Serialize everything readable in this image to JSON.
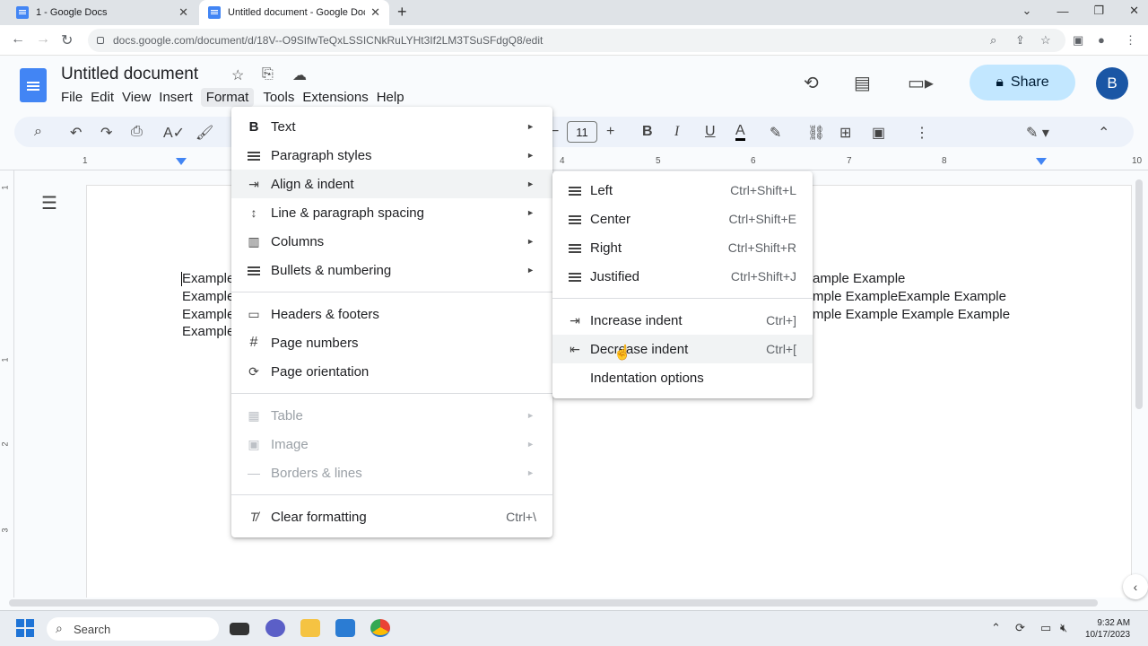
{
  "browser": {
    "tabs": [
      {
        "title": "1 - Google Docs",
        "active": false
      },
      {
        "title": "Untitled document - Google Docs",
        "active": true
      }
    ],
    "url": "docs.google.com/document/d/18V--O9SIfwTeQxLSSICNkRuLYHt3If2LM3TSuSFdgQ8/edit"
  },
  "docs": {
    "title": "Untitled document",
    "menubar": [
      "File",
      "Edit",
      "View",
      "Insert",
      "Format",
      "Tools",
      "Extensions",
      "Help"
    ],
    "active_menu": "Format",
    "share_label": "Share",
    "avatar_letter": "B",
    "font_size": "11",
    "ruler_numbers": [
      "1",
      "4",
      "5",
      "6",
      "7",
      "8",
      "10"
    ],
    "vruler_numbers": [
      "1",
      "1",
      "2",
      "3"
    ],
    "document_lines": [
      {
        "left": "Example",
        "right": "ample Example"
      },
      {
        "left": "Example",
        "right": "mple ExampleExample Example"
      },
      {
        "left": "Example",
        "right": "mple Example Example Example"
      },
      {
        "left": "Example",
        "right": ""
      }
    ]
  },
  "format_menu": {
    "items": [
      {
        "label": "Text",
        "icon": "bold-icon",
        "submenu": true
      },
      {
        "label": "Paragraph styles",
        "icon": "paragraph-styles-icon",
        "submenu": true
      },
      {
        "label": "Align & indent",
        "icon": "align-indent-icon",
        "submenu": true,
        "highlighted": true
      },
      {
        "label": "Line & paragraph spacing",
        "icon": "line-spacing-icon",
        "submenu": true
      },
      {
        "label": "Columns",
        "icon": "columns-icon",
        "submenu": true
      },
      {
        "label": "Bullets & numbering",
        "icon": "bullets-icon",
        "submenu": true
      },
      {
        "label": "Headers & footers",
        "icon": "headers-footers-icon",
        "submenu": false
      },
      {
        "label": "Page numbers",
        "icon": "hash-icon",
        "submenu": false
      },
      {
        "label": "Page orientation",
        "icon": "page-orientation-icon",
        "submenu": false
      },
      {
        "label": "Table",
        "icon": "table-icon",
        "submenu": true,
        "disabled": true
      },
      {
        "label": "Image",
        "icon": "image-icon",
        "submenu": true,
        "disabled": true
      },
      {
        "label": "Borders & lines",
        "icon": "borders-lines-icon",
        "submenu": true,
        "disabled": true
      },
      {
        "label": "Clear formatting",
        "icon": "clear-formatting-icon",
        "shortcut": "Ctrl+\\"
      }
    ]
  },
  "align_submenu": {
    "items": [
      {
        "label": "Left",
        "icon": "align-left-icon",
        "shortcut": "Ctrl+Shift+L"
      },
      {
        "label": "Center",
        "icon": "align-center-icon",
        "shortcut": "Ctrl+Shift+E"
      },
      {
        "label": "Right",
        "icon": "align-right-icon",
        "shortcut": "Ctrl+Shift+R"
      },
      {
        "label": "Justified",
        "icon": "align-justify-icon",
        "shortcut": "Ctrl+Shift+J"
      },
      {
        "label": "Increase indent",
        "icon": "increase-indent-icon",
        "shortcut": "Ctrl+]"
      },
      {
        "label": "Decrease indent",
        "icon": "decrease-indent-icon",
        "shortcut": "Ctrl+[",
        "hovered": true
      },
      {
        "label": "Indentation options",
        "icon": "",
        "shortcut": ""
      }
    ]
  },
  "taskbar": {
    "search_placeholder": "Search",
    "time": "9:32 AM",
    "date": "10/17/2023"
  },
  "colors": {
    "accent": "#4285f4",
    "share_bg": "#c2e7ff",
    "avatar_bg": "#1a56a5"
  }
}
